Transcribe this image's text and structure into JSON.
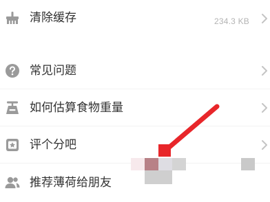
{
  "settings": {
    "items": [
      {
        "label": "清除缓存",
        "value": "234.3 KB",
        "icon": "broom-icon",
        "has_chevron": true
      },
      {
        "label": "常见问题",
        "icon": "question-icon",
        "has_chevron": true
      },
      {
        "label": "如何估算食物重量",
        "icon": "scale-icon",
        "has_chevron": true
      },
      {
        "label": "评个分吧",
        "icon": "rate-icon",
        "has_chevron": true
      },
      {
        "label": "推荐薄荷给朋友",
        "icon": "friends-icon",
        "has_chevron": false
      }
    ]
  },
  "colors": {
    "text": "#333333",
    "icon": "#9a9a9a",
    "value": "#b3b3b3",
    "chevron": "#c4c4c4",
    "annotation_arrow": "#e8262a"
  }
}
